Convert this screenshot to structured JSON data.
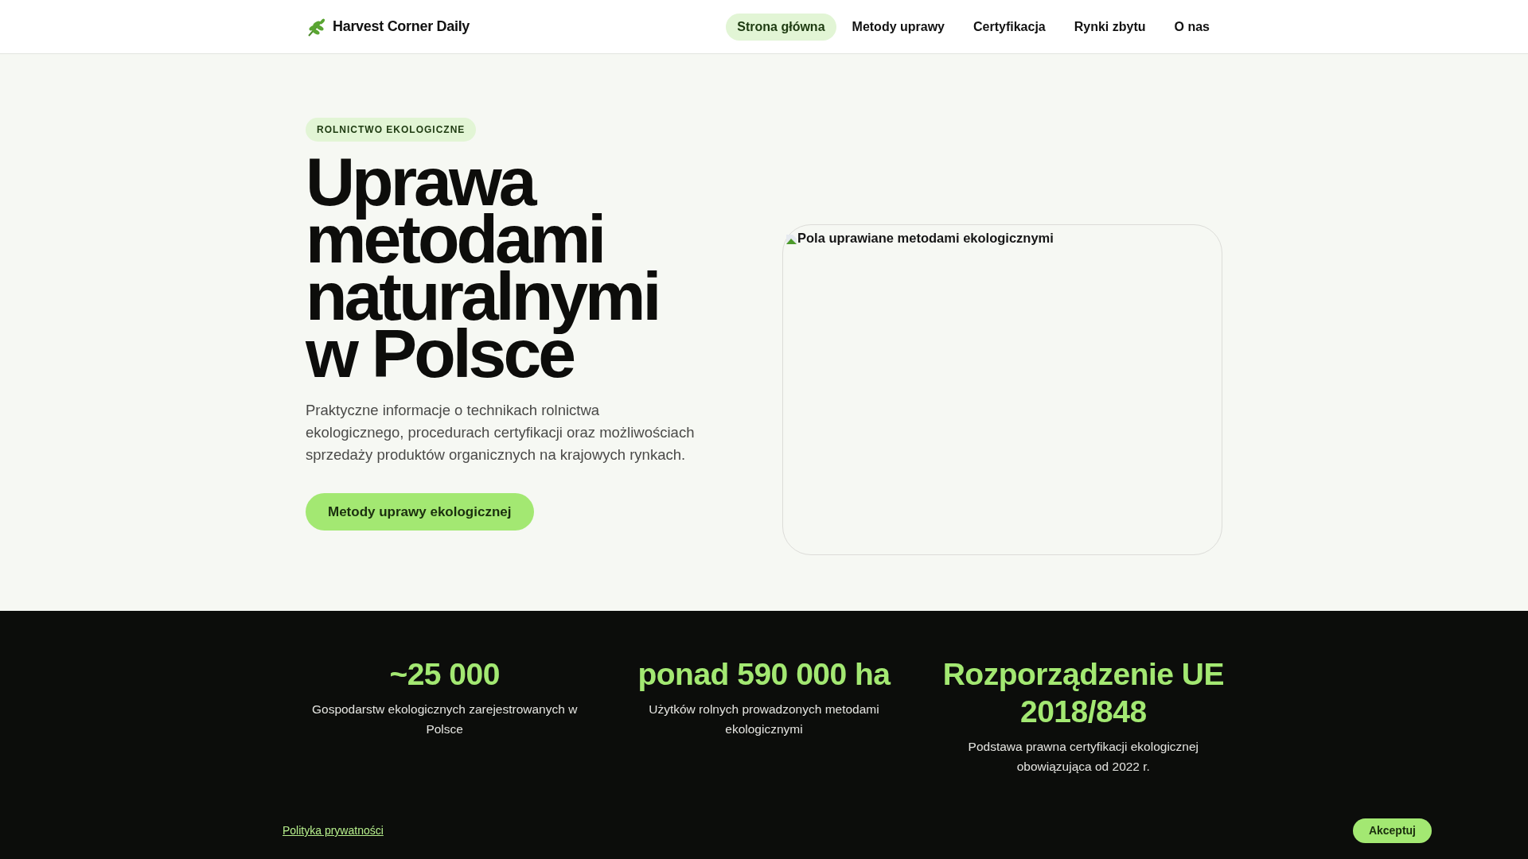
{
  "header": {
    "brand": "Harvest Corner Daily",
    "nav": [
      {
        "label": "Strona główna",
        "selected": true
      },
      {
        "label": "Metody uprawy",
        "selected": false
      },
      {
        "label": "Certyfikacja",
        "selected": false
      },
      {
        "label": "Rynki zbytu",
        "selected": false
      },
      {
        "label": "O nas",
        "selected": false
      }
    ]
  },
  "hero": {
    "badge": "ROLNICTWO EKOLOGICZNE",
    "title": "Uprawa metodami naturalnymi w Polsce",
    "lead": "Praktyczne informacje o technikach rolnictwa ekologicznego, procedurach certyfikacji oraz możliwościach sprzedaży produktów organicznych na krajowych rynkach.",
    "cta": "Metody uprawy ekologicznej",
    "image_alt": "Pola uprawiane metodami ekologicznymi"
  },
  "stats": [
    {
      "value": "~25 000",
      "label": "Gospodarstw ekologicznych zarejestrowanych w Polsce"
    },
    {
      "value": "ponad 590 000 ha",
      "label": "Użytków rolnych prowadzonych metodami ekologicznymi"
    },
    {
      "value": "Rozporządzenie UE 2018/848",
      "label": "Podstawa prawna certyfikacji ekologicznej obowiązująca od 2022 r."
    }
  ],
  "cookie_bar": {
    "link": "Polityka prywatności",
    "button": "Akceptuj"
  }
}
